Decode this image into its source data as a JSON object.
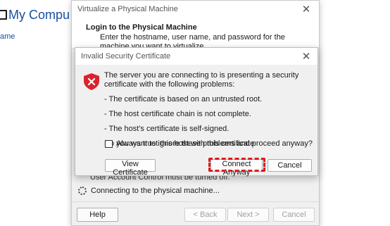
{
  "background": {
    "title": "My Compu",
    "column_label": "ame"
  },
  "wizard": {
    "title": "Virtualize a Physical Machine",
    "header_title": "Login to the Physical Machine",
    "header_subtitle": "Enter the hostname, user name, and password for the machine you want to virtualize.",
    "partial_text": "User Account Control must be turned off.",
    "status_text": "Connecting to the physical machine...",
    "buttons": {
      "help": "Help",
      "back": "< Back",
      "next": "Next >",
      "cancel": "Cancel"
    }
  },
  "security_dialog": {
    "title": "Invalid Security Certificate",
    "message": "The server you are connecting to is presenting a security certificate with the following problems:",
    "problems": [
      "- The certificate is based on an untrusted root.",
      "- The host certificate chain is not complete.",
      "- The host's certificate is self-signed."
    ],
    "question": "Do you want to ignore these problems and proceed anyway?",
    "trust_checkbox_label": "Always trust this host with this certificate",
    "trust_checked": false,
    "buttons": {
      "view_certificate": "View Certificate",
      "connect_anyway": "Connect Anyway",
      "cancel": "Cancel"
    },
    "icon": "shield-error-icon"
  },
  "colors": {
    "accent_highlight": "#e0181a",
    "shield": "#d9232e",
    "link_blue": "#1a4fa0"
  }
}
